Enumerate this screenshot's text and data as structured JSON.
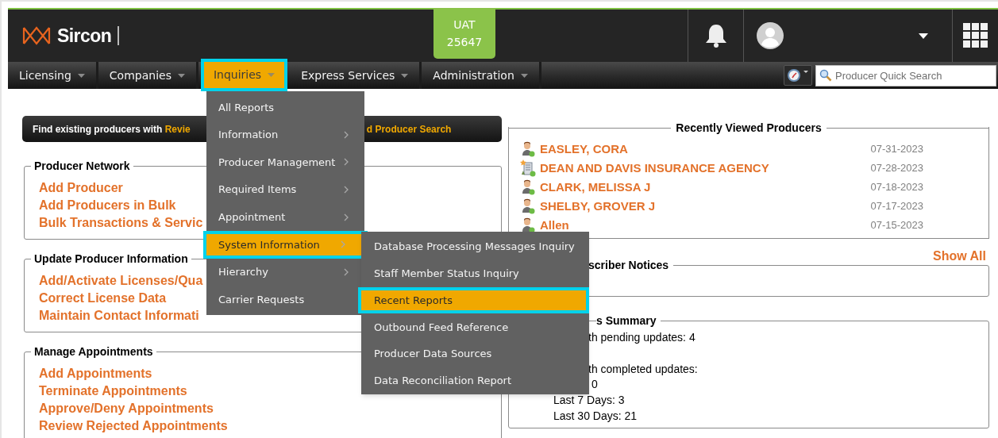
{
  "header": {
    "logo_text": "Sircon",
    "env_badge": [
      "UAT",
      "25647"
    ]
  },
  "nav": [
    {
      "label": "Licensing",
      "selected": false
    },
    {
      "label": "Companies",
      "selected": false
    },
    {
      "label": "Inquiries",
      "selected": true
    },
    {
      "label": "Express Services",
      "selected": false
    },
    {
      "label": "Administration",
      "selected": false
    }
  ],
  "quick_search": {
    "placeholder": "Producer Quick Search"
  },
  "dropdown": [
    {
      "label": "All Reports",
      "has_submenu": false,
      "selected": false
    },
    {
      "label": "Information",
      "has_submenu": true,
      "selected": false
    },
    {
      "label": "Producer Management",
      "has_submenu": true,
      "selected": false
    },
    {
      "label": "Required Items",
      "has_submenu": true,
      "selected": false
    },
    {
      "label": "Appointment",
      "has_submenu": true,
      "selected": false
    },
    {
      "label": "System Information",
      "has_submenu": true,
      "selected": true
    },
    {
      "label": "Hierarchy",
      "has_submenu": true,
      "selected": false
    },
    {
      "label": "Carrier Requests",
      "has_submenu": false,
      "selected": false
    }
  ],
  "submenu": [
    {
      "label": "Database Processing Messages Inquiry",
      "selected": false
    },
    {
      "label": "Staff Member Status Inquiry",
      "selected": false
    },
    {
      "label": "Recent Reports",
      "selected": true
    },
    {
      "label": "Outbound Feed Reference",
      "selected": false
    },
    {
      "label": "Producer Data Sources",
      "selected": false
    },
    {
      "label": "Data Reconciliation Report",
      "selected": false
    }
  ],
  "banner": {
    "prefix": "Find existing producers with",
    "link_start": "Revie",
    "link_end": "d Producer Search"
  },
  "sections": [
    {
      "title": "Producer Network",
      "links": [
        "Add Producer",
        "Add Producers in Bulk",
        "Bulk Transactions & Servic"
      ]
    },
    {
      "title": "Update Producer Information",
      "links": [
        "Add/Activate Licenses/Qua",
        "Correct License Data",
        "Maintain Contact Informati"
      ]
    },
    {
      "title": "Manage Appointments",
      "links": [
        "Add Appointments",
        "Terminate Appointments",
        "Approve/Deny Appointments",
        "Review Rejected Appointments"
      ]
    }
  ],
  "recent": {
    "title": "Recently Viewed Producers",
    "items": [
      {
        "name": "EASLEY, CORA",
        "date": "07-31-2023",
        "kind": "person"
      },
      {
        "name": "DEAN AND DAVIS INSURANCE AGENCY",
        "date": "07-28-2023",
        "kind": "agency"
      },
      {
        "name": "CLARK, MELISSA J",
        "date": "07-18-2023",
        "kind": "person"
      },
      {
        "name": "SHELBY, GROVER J",
        "date": "07-17-2023",
        "kind": "person"
      },
      {
        "name": "Allen",
        "date": "07-15-2023",
        "kind": "person"
      }
    ]
  },
  "notices": {
    "title": "scriber Notices",
    "show_all": "Show All"
  },
  "summary": {
    "title": "s Summary",
    "pending": [
      {
        "text": "th pending updates: 4",
        "kind": "cut"
      }
    ],
    "completed": [
      {
        "text": "th completed updates:",
        "kind": "cut"
      },
      {
        "text": "0",
        "kind": "cut"
      },
      {
        "text": "Last 7 Days: 3",
        "kind": "full"
      },
      {
        "text": "Last 30 Days: 21",
        "kind": "full"
      }
    ]
  }
}
